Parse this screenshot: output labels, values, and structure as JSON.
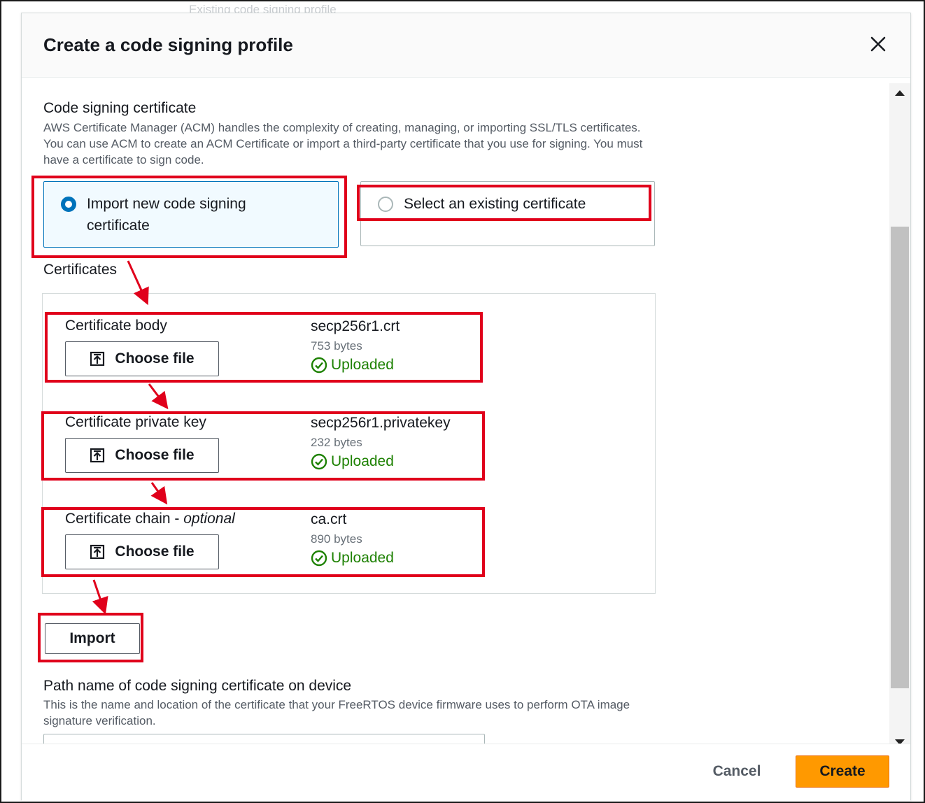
{
  "background": {
    "hint_text": "Existing code signing profile"
  },
  "modal": {
    "title": "Create a code signing profile",
    "close_icon": "close-icon"
  },
  "certificate_section": {
    "title": "Code signing certificate",
    "description": "AWS Certificate Manager (ACM) handles the complexity of creating, managing, or importing SSL/TLS certificates. You can use ACM to create an ACM Certificate or import a third-party certificate that you use for signing. You must have a certificate to sign code.",
    "options": [
      {
        "label": "Import new code signing certificate",
        "selected": true
      },
      {
        "label": "Select an existing certificate",
        "selected": false
      }
    ]
  },
  "certificates": {
    "title": "Certificates",
    "choose_label": "Choose file",
    "upload_icon": "upload-icon",
    "status_icon": "check-circle-icon",
    "items": [
      {
        "label": "Certificate body",
        "file_name": "secp256r1.crt",
        "file_size": "753 bytes",
        "status": "Uploaded"
      },
      {
        "label": "Certificate private key",
        "file_name": "secp256r1.privatekey",
        "file_size": "232 bytes",
        "status": "Uploaded"
      },
      {
        "label": "Certificate chain - ",
        "label_optional": "optional",
        "file_name": "ca.crt",
        "file_size": "890 bytes",
        "status": "Uploaded"
      }
    ],
    "import_label": "Import"
  },
  "path_section": {
    "title": "Path name of code signing certificate on device",
    "description": "This is the name and location of the certificate that your FreeRTOS device firmware uses to perform OTA image signature verification.",
    "input_value": ""
  },
  "footer": {
    "cancel_label": "Cancel",
    "create_label": "Create"
  },
  "colors": {
    "primary": "#0073bb",
    "success": "#1d8102",
    "create_button": "#ff9900",
    "annotation": "#e0001b"
  }
}
